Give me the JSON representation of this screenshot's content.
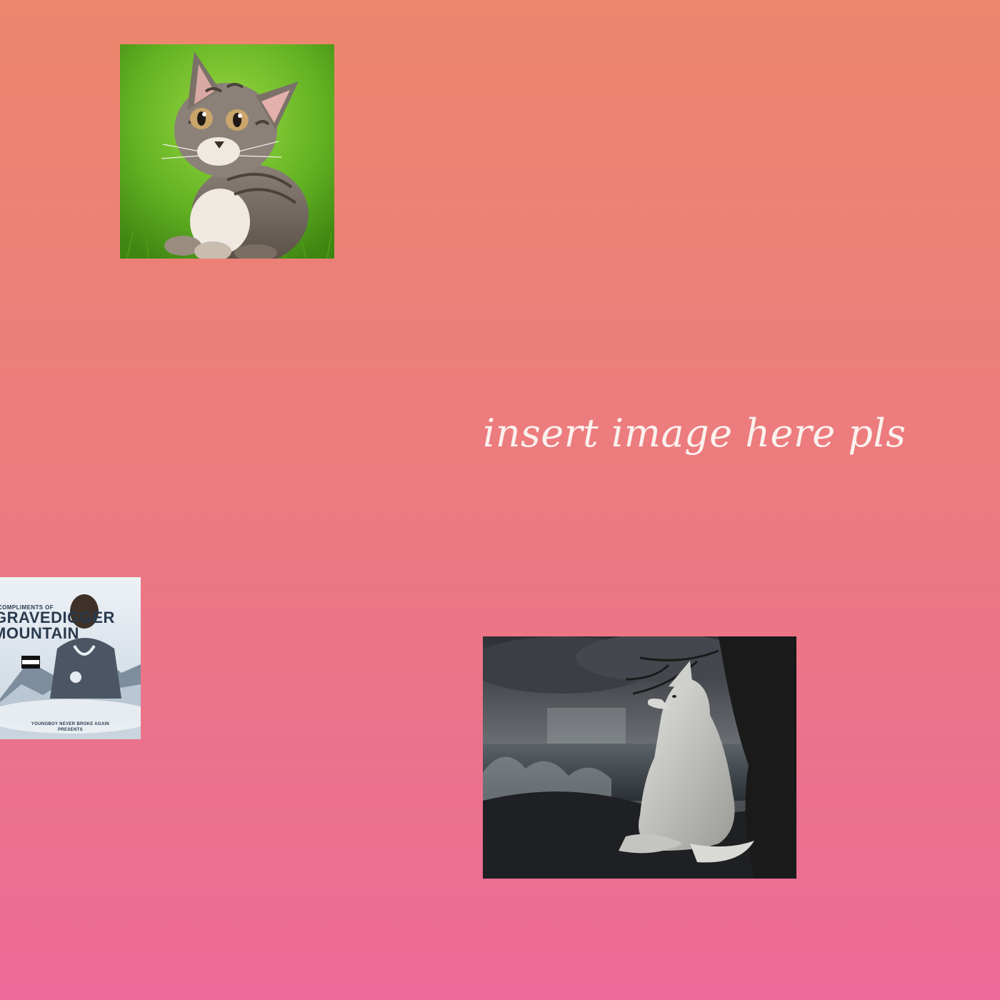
{
  "background": {
    "top_color": "#ed876d",
    "bottom_color": "#ec6a98"
  },
  "caption": {
    "text": "insert image here pls",
    "color": "#fbf1ee"
  },
  "images": [
    {
      "name": "kitten-photo",
      "subject": "tabby kitten sitting on green grass"
    },
    {
      "name": "album-cover",
      "subject": "album cover with snowy mountain and portrait"
    },
    {
      "name": "wolf-artwork",
      "subject": "white wolf sitting under a tree by a stormy sea"
    }
  ],
  "album": {
    "line_small": "COMPLIMENTS OF",
    "line_big_1": "GRAVEDIGGER",
    "line_big_2": "MOUNTAIN",
    "credit_1": "YOUNGBOY NEVER BROKE AGAIN",
    "credit_2": "PRESENTS"
  }
}
